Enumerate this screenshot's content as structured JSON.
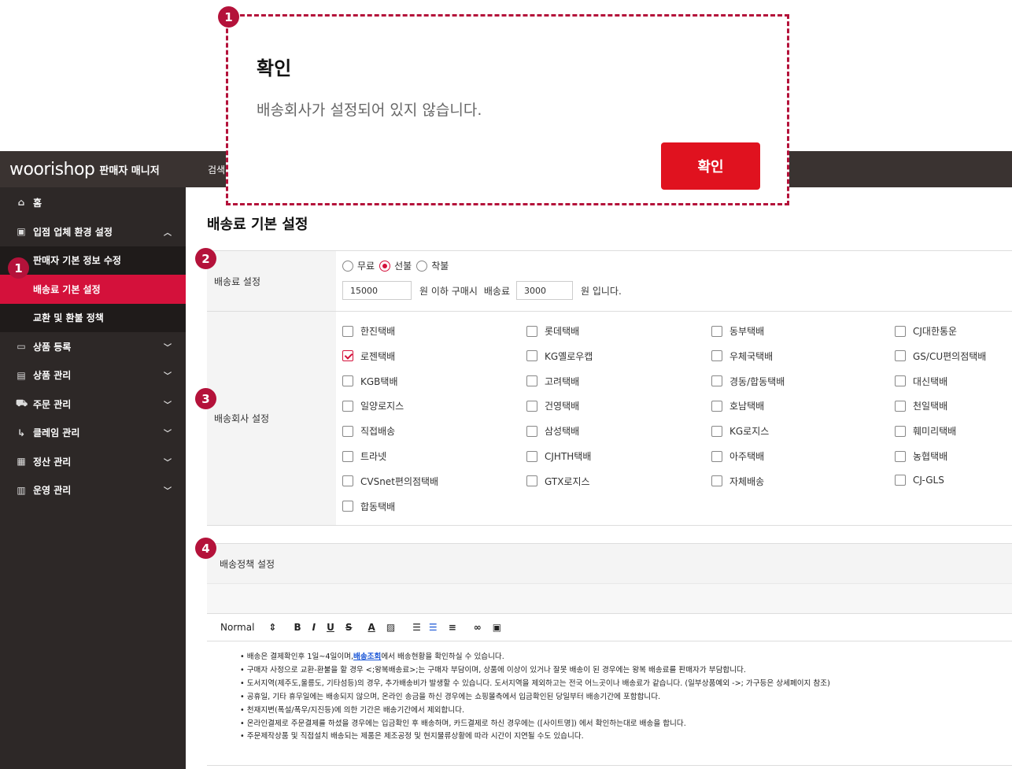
{
  "header": {
    "logo": "woorishop",
    "logo_sub": "판매자 매니저",
    "search_label": "검색"
  },
  "dialog": {
    "title": "확인",
    "message": "배송회사가 설정되어 있지 않습니다.",
    "confirm_label": "확인"
  },
  "badges": [
    "1",
    "1",
    "2",
    "3",
    "4"
  ],
  "sidebar": {
    "items": [
      {
        "icon": "home-icon",
        "label": "홈"
      },
      {
        "icon": "store-settings-icon",
        "label": "입점 업체 환경 설정",
        "expanded": true,
        "children": [
          {
            "label": "판매자 기본 정보 수정",
            "active": false
          },
          {
            "label": "배송료 기본 설정",
            "active": true
          },
          {
            "label": "교환 및 환불 정책",
            "active": false
          }
        ]
      },
      {
        "icon": "product-register-icon",
        "label": "상품 등록"
      },
      {
        "icon": "product-manage-icon",
        "label": "상품 관리"
      },
      {
        "icon": "cart-icon",
        "label": "주문 관리"
      },
      {
        "icon": "claim-icon",
        "label": "클레임 관리"
      },
      {
        "icon": "settlement-icon",
        "label": "정산 관리"
      },
      {
        "icon": "operation-icon",
        "label": "운영 관리"
      }
    ]
  },
  "main": {
    "title": "배송료 기본 설정",
    "fee": {
      "label": "배송료 설정",
      "options": [
        {
          "label": "무료",
          "checked": false
        },
        {
          "label": "선불",
          "checked": true
        },
        {
          "label": "착불",
          "checked": false
        }
      ],
      "threshold_value": "15000",
      "text_1": "원 이하 구매시",
      "text_2": "배송료",
      "fee_value": "3000",
      "text_3": "원 입니다."
    },
    "courier": {
      "label": "배송회사 설정",
      "items": [
        {
          "label": "한진택배",
          "checked": false
        },
        {
          "label": "롯데택배",
          "checked": false
        },
        {
          "label": "동부택배",
          "checked": false
        },
        {
          "label": "CJ대한통운",
          "checked": false
        },
        {
          "label": "로젠택배",
          "checked": true
        },
        {
          "label": "KG옐로우캡",
          "checked": false
        },
        {
          "label": "우체국택배",
          "checked": false
        },
        {
          "label": "GS/CU편의점택배",
          "checked": false
        },
        {
          "label": "KGB택배",
          "checked": false
        },
        {
          "label": "고려택배",
          "checked": false
        },
        {
          "label": "경동/합동택배",
          "checked": false
        },
        {
          "label": "대신택배",
          "checked": false
        },
        {
          "label": "일양로지스",
          "checked": false
        },
        {
          "label": "건영택배",
          "checked": false
        },
        {
          "label": "호남택배",
          "checked": false
        },
        {
          "label": "천일택배",
          "checked": false
        },
        {
          "label": "직접배송",
          "checked": false
        },
        {
          "label": "삼성택배",
          "checked": false
        },
        {
          "label": "KG로지스",
          "checked": false
        },
        {
          "label": "훼미리택배",
          "checked": false
        },
        {
          "label": "트라넷",
          "checked": false
        },
        {
          "label": "CJHTH택배",
          "checked": false
        },
        {
          "label": "아주택배",
          "checked": false
        },
        {
          "label": "농협택배",
          "checked": false
        },
        {
          "label": "CVSnet편의점택배",
          "checked": false
        },
        {
          "label": "GTX로지스",
          "checked": false
        },
        {
          "label": "자체배송",
          "checked": false
        },
        {
          "label": "CJ-GLS",
          "checked": false
        },
        {
          "label": "합동택배",
          "checked": false
        }
      ]
    },
    "policy": {
      "label": "배송정책 설정",
      "toolbar": {
        "format": "Normal",
        "icons": [
          "format-select-icon",
          "bold-icon",
          "italic-icon",
          "underline-icon",
          "strike-icon",
          "text-color-icon",
          "background-color-icon",
          "ordered-list-icon",
          "bullet-list-icon",
          "align-icon",
          "link-icon",
          "image-icon"
        ]
      },
      "lines": [
        {
          "pre": "• 배송은 결제확인후 1일~4일이며,",
          "link": "배송조회",
          "post": "에서 배송현황을 확인하실 수 있습니다."
        },
        {
          "pre": "• 구매자 사정으로 교환-환불을 할 경우 <;왕복배송료>;는 구매자 부담이며, 상품에 이상이 있거나 잘못 배송이 된 경우에는 왕복 배송료를 판매자가 부담합니다.",
          "link": "",
          "post": ""
        },
        {
          "pre": "• 도서지역(제주도,울릉도, 기타섬등)의 경우, 추가배송비가 발생할 수 있습니다. 도서지역을 제외하고는 전국 어느곳이나 배송료가 같습니다. (일부상품예외 ->; 가구등은 상세페이지 참조)",
          "link": "",
          "post": ""
        },
        {
          "pre": "• 공휴일, 기타 휴무일에는 배송되지 않으며, 온라인 송금을 하신 경우에는 쇼핑몰측에서 입금확인된 당일부터 배송기간에 포함합니다.",
          "link": "",
          "post": ""
        },
        {
          "pre": "• 천재지변(폭설/폭우/지진등)에 의한 기간은 배송기간에서 제외합니다.",
          "link": "",
          "post": ""
        },
        {
          "pre": "• 온라인결제로 주문결제를 하셨을 경우에는 입금확인 후 배송하며, 카드결제로 하신 경우에는 ([사이트명]) 에서 확인하는대로 배송을 합니다.",
          "link": "",
          "post": ""
        },
        {
          "pre": "• 주문제작상품 및 직접설치 배송되는 제품은 제조공정 및 현지물류상황에 따라 시간이 지연될 수도 있습니다.",
          "link": "",
          "post": ""
        }
      ]
    }
  }
}
